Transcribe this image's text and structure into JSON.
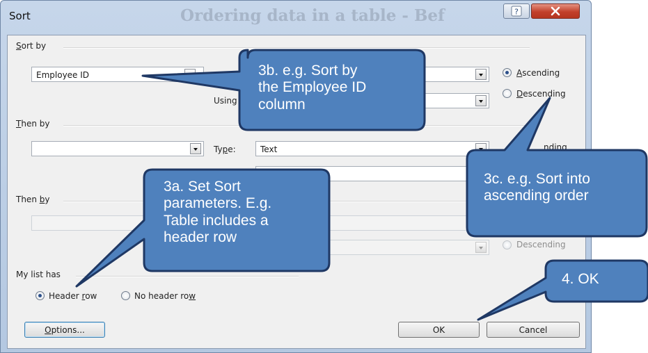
{
  "window": {
    "title": "Sort",
    "background_title": "Ordering data in a table - Bef",
    "help_label": "?",
    "close_label": "X"
  },
  "sort_by": {
    "section_label": "Sort by",
    "column_value": "Employee ID",
    "using_label": "Using"
  },
  "then_by_1": {
    "section_label": "Then by",
    "column_value": "",
    "type_label": "Type:",
    "type_value": "Text",
    "partial_label": "nding"
  },
  "then_by_2": {
    "section_label": "Then by",
    "descending_label": "Descending"
  },
  "order": {
    "ascending_label": "Ascending",
    "descending_label": "Descending",
    "selected": "Ascending"
  },
  "list_has": {
    "label": "My list has",
    "header_row_label": "Header row",
    "no_header_row_label": "No header row",
    "selected": "Header row"
  },
  "buttons": {
    "options_label": "Options...",
    "ok_label": "OK",
    "cancel_label": "Cancel"
  },
  "callouts": {
    "c3b": [
      "3b. e.g. Sort by",
      "the Employee ID",
      "column"
    ],
    "c3a": [
      "3a. Set Sort",
      "parameters. E.g.",
      "Table includes a",
      "header row"
    ],
    "c3c": [
      "3c. e.g. Sort into",
      "ascending order"
    ],
    "c4": [
      "4. OK"
    ]
  },
  "colors": {
    "callout_fill": "#4f81bd",
    "callout_border": "#1f3864",
    "close_button": "#c2402b",
    "title_bar": "#c6d6ea"
  }
}
